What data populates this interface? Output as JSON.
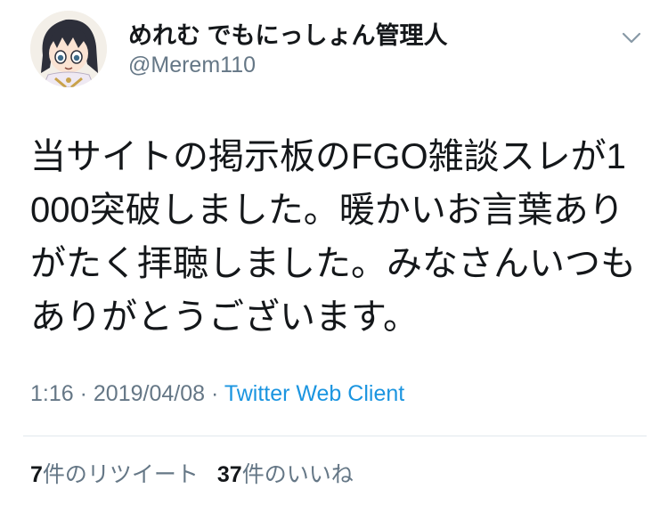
{
  "author": {
    "display_name": "めれむ でもにっしょん管理人",
    "handle": "@Merem110",
    "avatar_icon": "avatar-anime-character-icon"
  },
  "menu": {
    "icon": "chevron-down-icon"
  },
  "tweet": {
    "text": "当サイトの掲示板のFGO雑談スレが1000突破しました。暖かいお言葉ありがたく拝聴しました。みなさんいつもありがとうございます。",
    "time": "1:16",
    "separator": "·",
    "date": "2019/04/08",
    "source": "Twitter Web Client"
  },
  "stats": {
    "retweets_count": "7",
    "retweets_label": "件のリツイート",
    "likes_count": "37",
    "likes_label": "件のいいね"
  },
  "colors": {
    "text": "#14171a",
    "secondary": "#657786",
    "link": "#1b95e0",
    "divider": "#e1e8ed"
  }
}
